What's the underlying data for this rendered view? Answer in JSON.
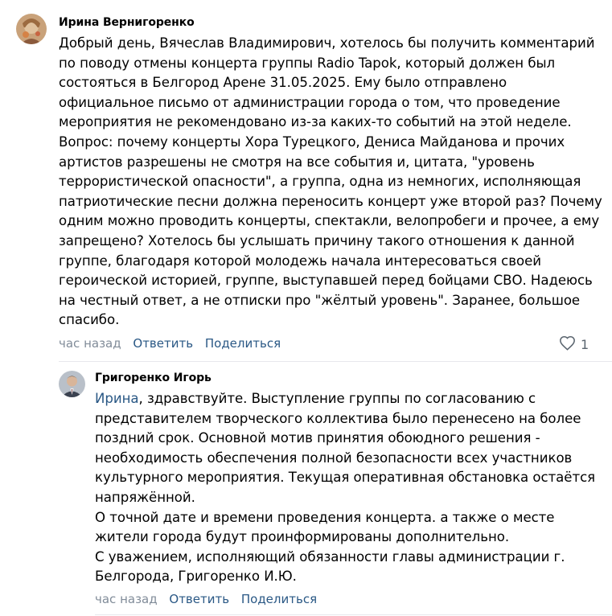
{
  "comments": [
    {
      "author": "Ирина Вернигоренко",
      "lines": [
        "Добрый день, Вячеслав Владимирович, хотелось бы получить комментарий",
        "по поводу отмены концерта группы Radio Tapok, который должен был",
        "состояться в Белгород Арене 31.05.2025. Ему было отправлено",
        "официальное письмо от администрации города о том, что проведение",
        "мероприятия не рекомендовано из-за каких-то событий на этой неделе.",
        "Вопрос: почему концерты Хора Турецкого, Дениса Майданова и прочих",
        "артистов разрешены не смотря на все события и, цитата, \"уровень",
        "террористической опасности\", а группа, одна из немногих, исполняющая",
        "патриотические песни должна переносить концерт уже второй раз? Почему",
        "одним можно проводить концерты, спектакли, велопробеги и прочее, а ему",
        "запрещено? Хотелось бы услышать причину такого отношения к данной",
        "группе, благодаря которой молодежь начала интересоваться своей",
        "героической историей, группе, выступавшей перед бойцами СВО. Надеюсь",
        "на честный ответ, а не отписки про \"жёлтый уровень\". Заранее, большое",
        "спасибо."
      ],
      "time": "час назад",
      "reply_label": "Ответить",
      "share_label": "Поделиться",
      "like_count": "1",
      "like_icon": "heart-outline-icon"
    },
    {
      "author": "Григоренко Игорь",
      "mention": "Ирина",
      "first_line_rest": ", здравствуйте. Выступление группы по согласованию с",
      "lines": [
        "представителем творческого коллектива было перенесено на более",
        "поздний срок. Основной мотив принятия обоюдного решения -",
        "необходимость обеспечения полной безопасности всех участников",
        "культурного мероприятия. Текущая оперативная обстановка остаётся",
        "напряжённой.",
        "О точной дате и времени проведения концерта. а также о месте",
        "жители города будут проинформированы дополнительно.",
        "С уважением, исполняющий обязанности главы администрации г.",
        "Белгорода, Григоренко И.Ю."
      ],
      "time": "час назад",
      "reply_label": "Ответить",
      "share_label": "Поделиться"
    }
  ],
  "colors": {
    "link": "#2a5885",
    "meta": "#818c99",
    "divider": "#e7e8ec"
  }
}
